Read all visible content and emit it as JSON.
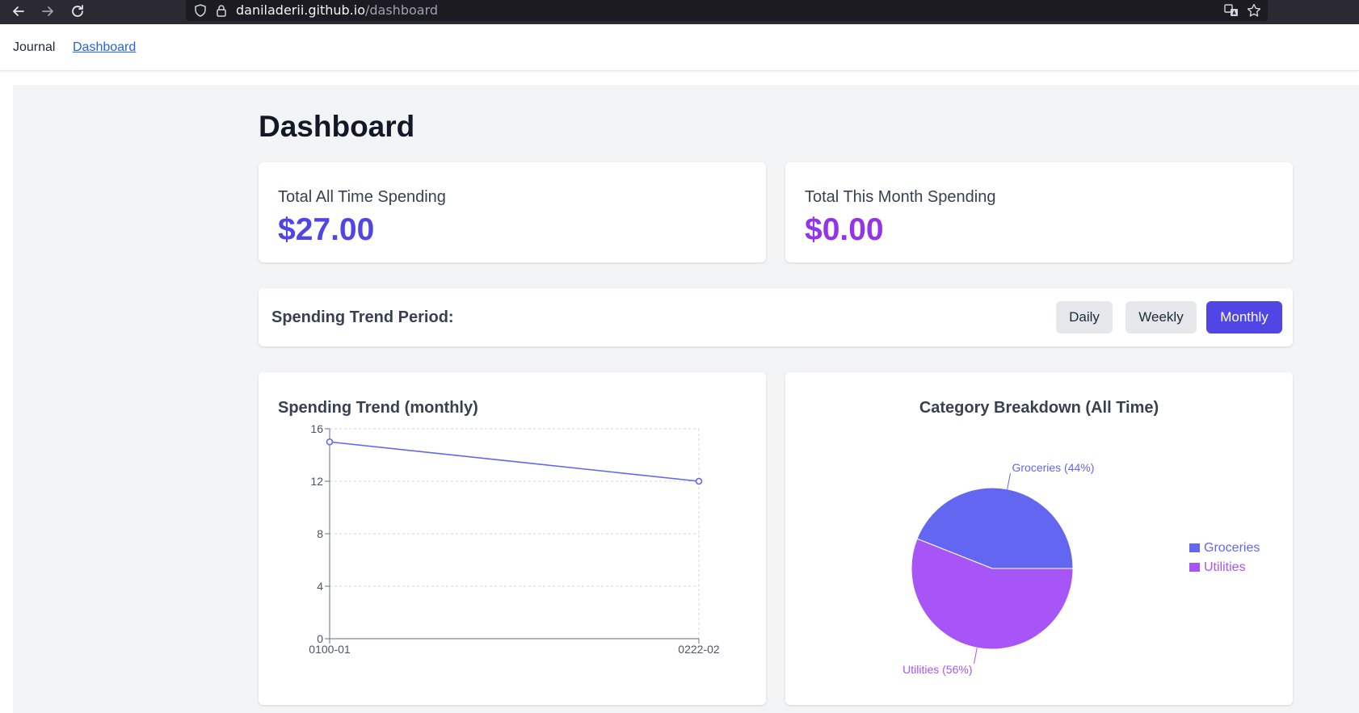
{
  "browser": {
    "url_host": "daniladerii.github.io",
    "url_path": "/dashboard"
  },
  "nav": {
    "journal": "Journal",
    "dashboard": "Dashboard"
  },
  "page": {
    "title": "Dashboard"
  },
  "stats": {
    "total_label": "Total All Time Spending",
    "total_value": "$27.00",
    "month_label": "Total This Month Spending",
    "month_value": "$0.00"
  },
  "period": {
    "label": "Spending Trend Period:",
    "options": [
      "Daily",
      "Weekly",
      "Monthly"
    ],
    "selected": "Monthly"
  },
  "colors": {
    "accent": "#4f46e5",
    "line": "#6366f1",
    "groceries": "#6366f1",
    "utilities": "#a855f7",
    "month_value": "#9333ea"
  },
  "chart_data": [
    {
      "type": "line",
      "title": "Spending Trend (monthly)",
      "x": [
        "0100-01",
        "0222-02"
      ],
      "series": [
        {
          "values": [
            15,
            12
          ]
        }
      ],
      "ylim": [
        0,
        16
      ],
      "yticks": [
        0,
        4,
        8,
        12,
        16
      ],
      "grid": true
    },
    {
      "type": "pie",
      "title": "Category Breakdown (All Time)",
      "slices": [
        {
          "label": "Groceries",
          "percent": 44,
          "slice_label": "Groceries (44%)"
        },
        {
          "label": "Utilities",
          "percent": 56,
          "slice_label": "Utilities (56%)"
        }
      ],
      "legend": "right"
    }
  ]
}
